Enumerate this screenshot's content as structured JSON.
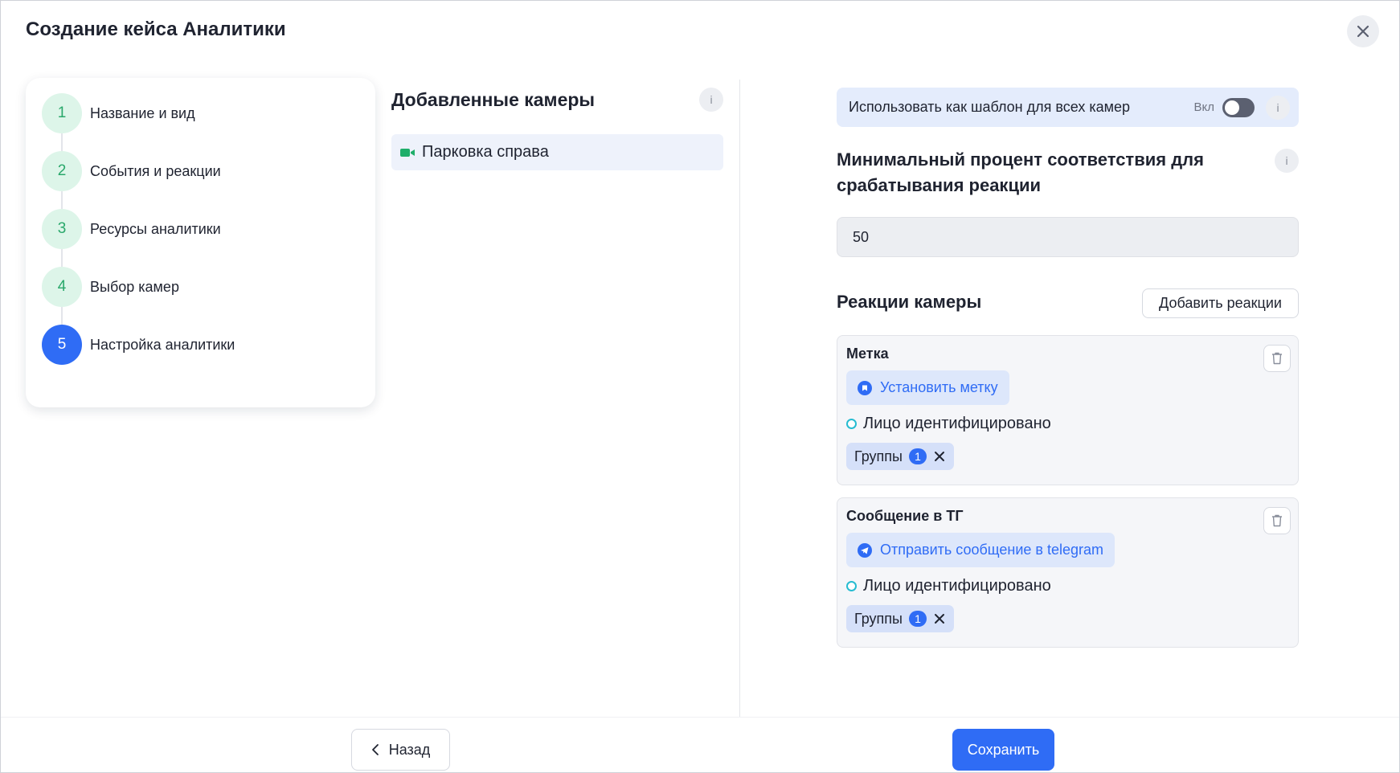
{
  "header": {
    "title": "Создание кейса Аналитики"
  },
  "stepper": {
    "steps": [
      {
        "number": "1",
        "label": "Название и вид"
      },
      {
        "number": "2",
        "label": "События и реакции"
      },
      {
        "number": "3",
        "label": "Ресурсы аналитики"
      },
      {
        "number": "4",
        "label": "Выбор камер"
      },
      {
        "number": "5",
        "label": "Настройка аналитики"
      }
    ],
    "active_step": "5"
  },
  "cameras": {
    "title": "Добавленные камеры",
    "info_icon": "i",
    "items": [
      {
        "label": "Парковка справа",
        "icon": "video-camera-icon"
      }
    ]
  },
  "settings": {
    "template": {
      "label": "Использовать как шаблон для всех камер",
      "toggle_label": "Вкл",
      "enabled": false,
      "info_icon": "i"
    },
    "min_percent": {
      "title": "Минимальный процент соответствия для срабатывания реакции",
      "value": "50",
      "info_icon": "i"
    },
    "reactions": {
      "title": "Реакции камеры",
      "add_button": "Добавить реакции",
      "cards": [
        {
          "title": "Метка",
          "action": "Установить метку",
          "action_icon": "tag-icon",
          "condition": "Лицо идентифицировано",
          "group_label": "Группы",
          "group_count": "1"
        },
        {
          "title": "Сообщение в ТГ",
          "action": "Отправить сообщение в telegram",
          "action_icon": "telegram-icon",
          "condition": "Лицо идентифицировано",
          "group_label": "Группы",
          "group_count": "1"
        }
      ]
    }
  },
  "footer": {
    "back_label": "Назад",
    "save_label": "Сохранить"
  },
  "colors": {
    "accent": "#2f6cf5",
    "step_done_bg": "#ddf5e9",
    "step_done_fg": "#2aa86b",
    "camera_icon": "#1fae6a"
  }
}
